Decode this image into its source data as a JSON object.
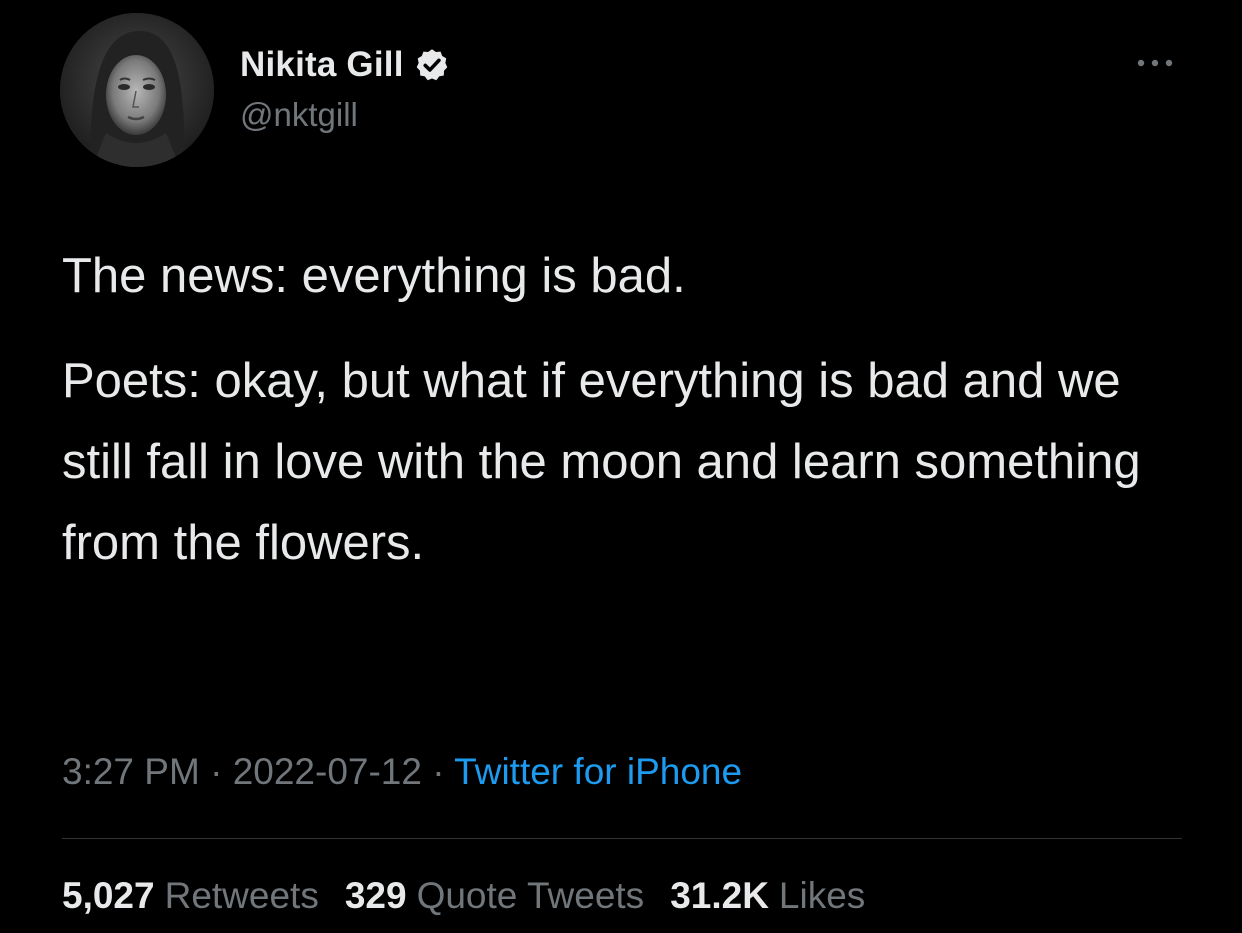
{
  "author": {
    "display_name": "Nikita Gill",
    "handle": "@nktgill",
    "avatar_icon": "avatar-portrait",
    "verified_icon": "verified-badge-icon"
  },
  "tweet": {
    "paragraphs": [
      "The news: everything is bad.",
      "Poets: okay, but what if everything is bad and we still fall in love with the moon and learn something from the flowers."
    ],
    "time": "3:27 PM",
    "separator": "·",
    "date": "2022-07-12",
    "source": "Twitter for iPhone"
  },
  "stats": {
    "retweets": {
      "count": "5,027",
      "label": "Retweets"
    },
    "quotes": {
      "count": "329",
      "label": "Quote Tweets"
    },
    "likes": {
      "count": "31.2K",
      "label": "Likes"
    }
  },
  "colors": {
    "background": "#000000",
    "text_primary": "#e7e9ea",
    "text_secondary": "#71767b",
    "link": "#1d9bf0",
    "divider": "#2f3336"
  }
}
